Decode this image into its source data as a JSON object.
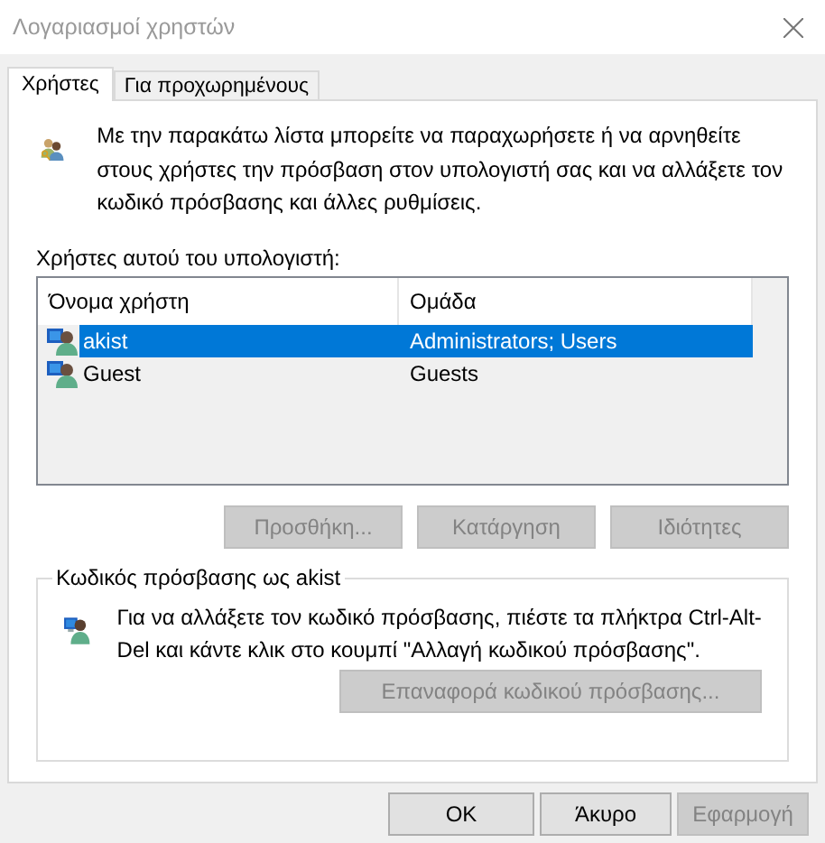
{
  "window": {
    "title": "Λογαριασμοί χρηστών"
  },
  "tabs": [
    {
      "label": "Χρήστες",
      "selected": true
    },
    {
      "label": "Για προχωρημένους",
      "selected": false
    }
  ],
  "intro": "Με την παρακάτω λίστα μπορείτε να παραχωρήσετε ή να αρνηθείτε στους χρήστες την πρόσβαση στον υπολογιστή σας και να αλλάξετε τον κωδικό πρόσβασης και άλλες ρυθμίσεις.",
  "users_label": "Χρήστες αυτού του υπολογιστή:",
  "table": {
    "columns": [
      "Όνομα χρήστη",
      "Ομάδα"
    ],
    "rows": [
      {
        "name": "akist",
        "group": "Administrators; Users",
        "selected": true
      },
      {
        "name": "Guest",
        "group": "Guests",
        "selected": false
      }
    ]
  },
  "list_buttons": [
    {
      "label": "Προσθήκη...",
      "disabled": true
    },
    {
      "label": "Κατάργηση",
      "disabled": true
    },
    {
      "label": "Ιδιότητες",
      "disabled": true
    }
  ],
  "password_group": {
    "title": "Κωδικός πρόσβασης ως akist",
    "text": "Για να αλλάξετε τον κωδικό πρόσβασης, πιέστε τα πλήκτρα Ctrl-Alt-Del και κάντε κλικ στο κουμπί \"Αλλαγή κωδικού πρόσβασης\".",
    "button": {
      "label": "Επαναφορά κωδικού πρόσβασης...",
      "disabled": true
    }
  },
  "dialog_buttons": [
    {
      "label": "OK",
      "disabled": false
    },
    {
      "label": "Άκυρο",
      "disabled": false
    },
    {
      "label": "Εφαρμογή",
      "disabled": true
    }
  ]
}
